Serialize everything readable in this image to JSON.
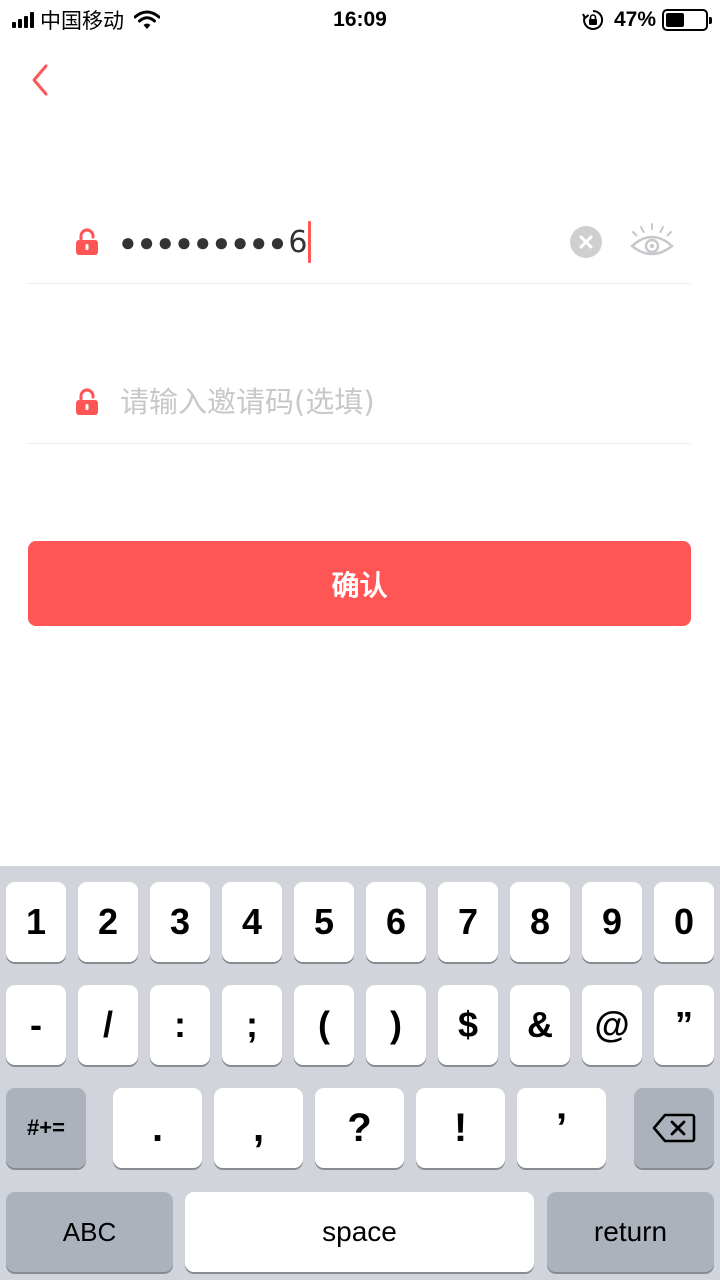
{
  "status_bar": {
    "carrier": "中国移动",
    "time": "16:09",
    "battery_percent": "47%",
    "battery_level": 0.47
  },
  "form": {
    "password_masked": "●●●●●●●●●",
    "password_last_char": "6",
    "invite_placeholder": "请输入邀请码(选填)",
    "confirm_label": "确认"
  },
  "icons": {
    "back": "chevron-left-icon",
    "lock": "lock-icon",
    "clear": "clear-icon",
    "eye": "eye-icon"
  },
  "colors": {
    "accent": "#ff5555",
    "placeholder": "#c8c8cc",
    "keyboard_bg": "#d1d4da"
  },
  "keyboard": {
    "row1": [
      "1",
      "2",
      "3",
      "4",
      "5",
      "6",
      "7",
      "8",
      "9",
      "0"
    ],
    "row2": [
      "-",
      "/",
      ":",
      ";",
      "(",
      ")",
      "$",
      "&",
      "@",
      "”"
    ],
    "row3": [
      ".",
      ",",
      "?",
      "!",
      "’"
    ],
    "symbols_label": "#+=",
    "abc_label": "ABC",
    "space_label": "space",
    "return_label": "return"
  }
}
